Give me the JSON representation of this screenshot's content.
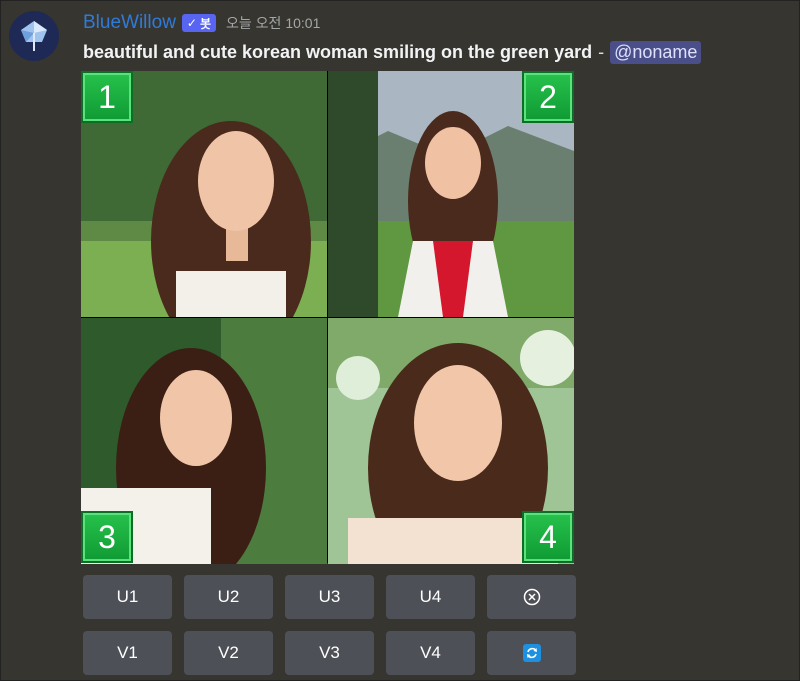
{
  "author": {
    "name": "BlueWillow",
    "bot_tag": "봇",
    "timestamp": "오늘 오전 10:01"
  },
  "message": {
    "prompt": "beautiful and cute korean woman smiling on the green yard",
    "separator": "-",
    "mention": "@noname"
  },
  "grid": {
    "badges": [
      "1",
      "2",
      "3",
      "4"
    ]
  },
  "upscale_buttons": [
    "U1",
    "U2",
    "U3",
    "U4"
  ],
  "variation_buttons": [
    "V1",
    "V2",
    "V3",
    "V4"
  ],
  "icons": {
    "cancel": "cancel-circle-icon",
    "reroll": "reroll-icon"
  },
  "colors": {
    "username": "#2f7bd9",
    "bot_tag": "#5865f2",
    "badge": "#1fb043",
    "button": "#4e5058",
    "reroll": "#1e90e0"
  }
}
